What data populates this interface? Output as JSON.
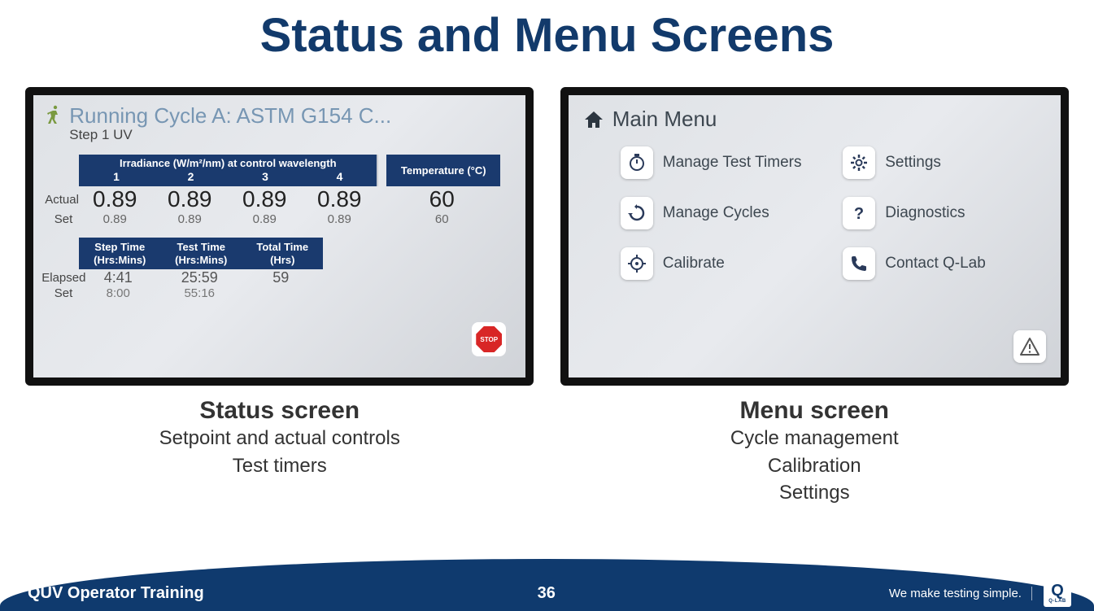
{
  "title": "Status and Menu Screens",
  "left_panel": {
    "cycle_title": "Running Cycle A: ASTM G154 C...",
    "step_label": "Step 1 UV",
    "irr_header": "Irradiance (W/m²/nm) at control wavelength",
    "irr_cols": [
      "1",
      "2",
      "3",
      "4"
    ],
    "temp_header": "Temperature (°C)",
    "row_actual_label": "Actual",
    "row_set_label": "Set",
    "actual_irr": [
      "0.89",
      "0.89",
      "0.89",
      "0.89"
    ],
    "actual_temp": "60",
    "set_irr": [
      "0.89",
      "0.89",
      "0.89",
      "0.89"
    ],
    "set_temp": "60",
    "time_headers": [
      "Step Time\n(Hrs:Mins)",
      "Test Time\n(Hrs:Mins)",
      "Total Time\n(Hrs)"
    ],
    "elapsed_label": "Elapsed",
    "elapsed": [
      "4:41",
      "25:59",
      "59"
    ],
    "set2_label": "Set",
    "set2": [
      "8:00",
      "55:16",
      ""
    ],
    "stop_label": "STOP"
  },
  "right_panel": {
    "title": "Main Menu",
    "items": [
      {
        "label": "Manage Test Timers",
        "icon": "timer-icon"
      },
      {
        "label": "Settings",
        "icon": "gear-icon"
      },
      {
        "label": "Manage Cycles",
        "icon": "cycle-icon"
      },
      {
        "label": "Diagnostics",
        "icon": "question-icon"
      },
      {
        "label": "Calibrate",
        "icon": "target-icon"
      },
      {
        "label": "Contact Q-Lab",
        "icon": "phone-icon"
      }
    ]
  },
  "captions": {
    "left_h": "Status screen",
    "left_lines": [
      "Setpoint and actual controls",
      "Test timers"
    ],
    "right_h": "Menu screen",
    "right_lines": [
      "Cycle management",
      "Calibration",
      "Settings"
    ]
  },
  "footer": {
    "left": "QUV Operator Training",
    "page": "36",
    "tagline": "We make testing simple.",
    "logo_top": "Q",
    "logo_bottom": "Q-LAB"
  }
}
